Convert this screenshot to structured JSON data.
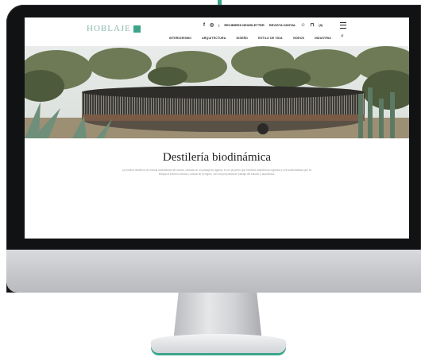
{
  "site": {
    "logo_text": "HOBLAJE",
    "accent_color": "#3aa58a",
    "utility": {
      "icons": [
        "facebook-icon",
        "instagram-icon"
      ],
      "newsletter_label": "RECIBIRES NEWSLETTER",
      "edition_label": "REVISTA DIGITAL",
      "cart_count": "(0)"
    },
    "nav": [
      "INTERIORISMO",
      "ARQUITECTURA",
      "DISEÑO",
      "ESTILO DE VIDA",
      "VIDEOS",
      "INDUSTRIA"
    ]
  },
  "article": {
    "title": "Destilería biodinámica",
    "excerpt": "La primera destilería de mezcal biodinámica del mundo, ubicada en un paisaje de agaves, es un proyecto que combina arquitectura orgánica y una sostenibilidad que se integra al entorno natural y cultural de la región, con una propuesta de paisaje del estudio y arquitectos."
  }
}
